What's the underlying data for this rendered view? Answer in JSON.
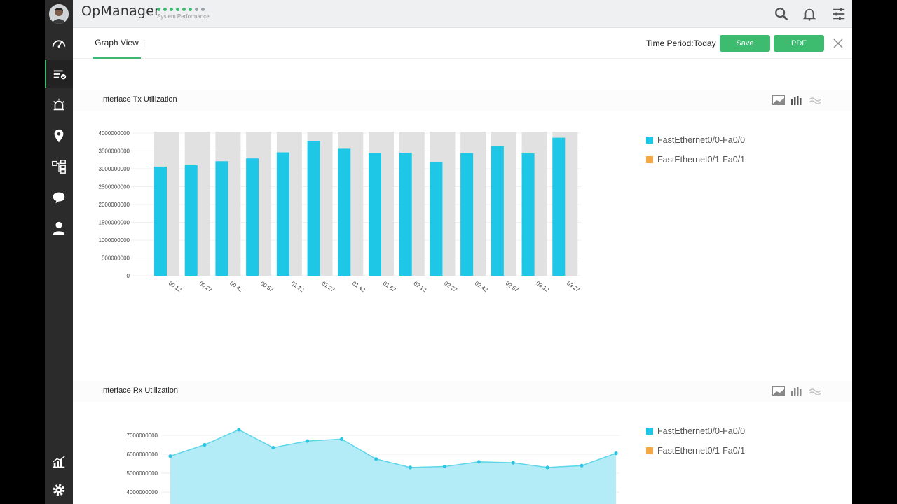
{
  "header": {
    "app_title": "OpManager",
    "perf_label": "System Performance",
    "perf_dots_active": 6,
    "perf_dots_total": 8
  },
  "toolbar": {
    "tab_graph_view": "Graph View",
    "separator": "|",
    "time_period": "Time Period:Today",
    "save_label": "Save",
    "pdf_label": "PDF"
  },
  "sidebar": {
    "items": [
      "dashboard-icon",
      "inventory-icon",
      "alarms-icon",
      "maps-icon",
      "workflow-icon",
      "chat-icon",
      "user-icon",
      "reports-icon",
      "settings-icon"
    ]
  },
  "colors": {
    "accent": "#3dbb6e",
    "series1": "#1ec7e6",
    "series2": "#f4a742",
    "bar_bg": "#e1e1e1"
  },
  "panels": {
    "tx_title": "Interface Tx Utilization",
    "rx_title": "Interface Rx Utilization",
    "legend": [
      "FastEthernet0/0-Fa0/0",
      "FastEthernet0/1-Fa0/1"
    ]
  },
  "chart_data": [
    {
      "type": "bar",
      "title": "Interface Tx Utilization",
      "categories": [
        "00:12",
        "00:27",
        "00:42",
        "00:57",
        "01:12",
        "01:27",
        "01:42",
        "01:57",
        "02:12",
        "02:27",
        "02:42",
        "02:57",
        "03:12",
        "03:27"
      ],
      "series": [
        {
          "name": "FastEthernet0/0-Fa0/0",
          "values": [
            3060000000,
            3100000000,
            3210000000,
            3290000000,
            3460000000,
            3780000000,
            3560000000,
            3440000000,
            3450000000,
            3180000000,
            3440000000,
            3640000000,
            3430000000,
            3870000000
          ]
        },
        {
          "name": "FastEthernet0/1-Fa0/1",
          "values": []
        }
      ],
      "ylim": [
        0,
        4000000000
      ],
      "yticks": [
        "0",
        "500000000",
        "1000000000",
        "1500000000",
        "2000000000",
        "2500000000",
        "3000000000",
        "3500000000",
        "4000000000"
      ],
      "legend": "right"
    },
    {
      "type": "area",
      "title": "Interface Rx Utilization",
      "series": [
        {
          "name": "FastEthernet0/0-Fa0/0",
          "values": [
            5900000000,
            6500000000,
            7300000000,
            6350000000,
            6700000000,
            6800000000,
            5750000000,
            5300000000,
            5350000000,
            5600000000,
            5550000000,
            5300000000,
            5400000000,
            6050000000
          ]
        },
        {
          "name": "FastEthernet0/1-Fa0/1",
          "values": []
        }
      ],
      "yticks": [
        "4000000000",
        "5000000000",
        "6000000000",
        "7000000000"
      ],
      "legend": "right"
    }
  ]
}
